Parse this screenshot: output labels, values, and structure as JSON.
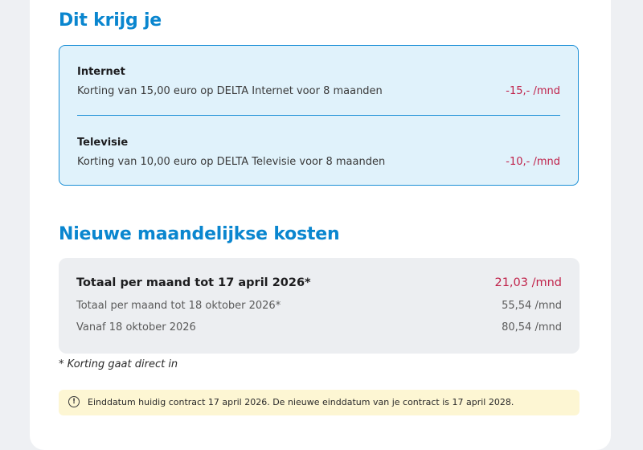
{
  "benefits": {
    "heading": "Dit krijg je",
    "sections": [
      {
        "title": "Internet",
        "description": "Korting van 15,00 euro op DELTA Internet voor 8 maanden",
        "amount": "-15,- /mnd"
      },
      {
        "title": "Televisie",
        "description": "Korting van 10,00 euro op DELTA Televisie voor 8 maanden",
        "amount": "-10,- /mnd"
      }
    ]
  },
  "costs": {
    "heading": "Nieuwe maandelijkse kosten",
    "rows": [
      {
        "label": "Totaal per maand tot 17 april 2026*",
        "value": "21,03 /mnd"
      },
      {
        "label": "Totaal per maand tot 18 oktober 2026*",
        "value": "55,54 /mnd"
      },
      {
        "label": "Vanaf 18 oktober 2026",
        "value": "80,54 /mnd"
      }
    ]
  },
  "footnote": "* Korting gaat direct in",
  "notice": {
    "icon": "info-alert-icon",
    "text": "Einddatum huidig contract 17 april 2026. De nieuwe einddatum van je contract is 17 april 2028."
  },
  "colors": {
    "accent": "#0a86cf",
    "price": "#c0224a",
    "discount_bg": "#e0f2fb",
    "notice_bg": "#fdf6d3"
  }
}
